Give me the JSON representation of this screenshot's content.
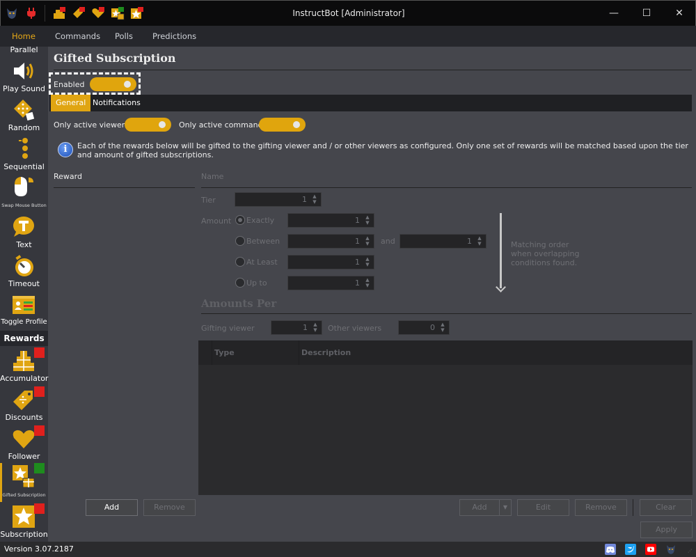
{
  "window": {
    "title": "InstructBot [Administrator]",
    "controls": {
      "minimize": "—",
      "maximize": "☐",
      "close": "✕"
    }
  },
  "toolbar_icons": [
    "bot-logo",
    "plug",
    "accumulator",
    "discounts",
    "follower",
    "gifted-subscription",
    "subscription"
  ],
  "menu": {
    "items": [
      {
        "label": "Home",
        "active": true
      },
      {
        "label": "Commands",
        "active": false
      },
      {
        "label": "Polls",
        "active": false
      },
      {
        "label": "Predictions",
        "active": false
      }
    ]
  },
  "sidebar": {
    "top_partial_label": "Parallel",
    "items": [
      {
        "label": "Play Sound",
        "icon": "speaker"
      },
      {
        "label": "Random",
        "icon": "dice"
      },
      {
        "label": "Sequential",
        "icon": "sequence"
      },
      {
        "label": "Swap Mouse Button",
        "icon": "mouse"
      },
      {
        "label": "Text",
        "icon": "text-bubble"
      },
      {
        "label": "Timeout",
        "icon": "stopwatch"
      },
      {
        "label": "Toggle Profile",
        "icon": "profile-toggle"
      }
    ],
    "rewards_header": "Rewards",
    "rewards": [
      {
        "label": "Accumulator",
        "icon": "gifts",
        "status": "red"
      },
      {
        "label": "Discounts",
        "icon": "tag",
        "status": "red"
      },
      {
        "label": "Follower",
        "icon": "heart",
        "status": "red"
      },
      {
        "label": "Gifted Subscription",
        "icon": "star-gift",
        "status": "green",
        "active": true
      },
      {
        "label": "Subscription",
        "icon": "star",
        "status": "red"
      }
    ]
  },
  "colors": {
    "accent": "#e0a512",
    "status_red": "#e0201d",
    "status_green": "#1e8c1e"
  },
  "main": {
    "title": "Gifted Subscription",
    "enabled_label": "Enabled",
    "enabled": true,
    "tabs": [
      {
        "label": "General",
        "active": true
      },
      {
        "label": "Notifications",
        "active": false
      }
    ],
    "only_active_viewers_label": "Only active viewers",
    "only_active_viewers": true,
    "only_active_commands_label": "Only active commands",
    "only_active_commands": true,
    "info_text": "Each of the rewards below will be gifted to the gifting viewer and / or other viewers as configured. Only one set of rewards will be matched based upon the tier and amount of gifted subscriptions.",
    "reward_list_header": "Reward",
    "form": {
      "name_label": "Name",
      "tier_label": "Tier",
      "tier_value": "1",
      "amount_label": "Amount",
      "amount_options": [
        {
          "label": "Exactly",
          "checked": true,
          "value": "1"
        },
        {
          "label": "Between",
          "checked": false,
          "value": "1",
          "and_label": "and",
          "value2": "1"
        },
        {
          "label": "At Least",
          "checked": false,
          "value": "1"
        },
        {
          "label": "Up to",
          "checked": false,
          "value": "1"
        }
      ],
      "matching_note": "Matching order when overlapping conditions found."
    },
    "amounts_per": {
      "title": "Amounts Per",
      "gifting_viewer_label": "Gifting viewer",
      "gifting_viewer_value": "1",
      "other_viewers_label": "Other viewers",
      "other_viewers_value": "0"
    },
    "grid": {
      "columns": [
        "Type",
        "Description"
      ],
      "rows": []
    },
    "buttons": {
      "reward_add": "Add",
      "reward_remove": "Remove",
      "item_add": "Add",
      "item_edit": "Edit",
      "item_remove": "Remove",
      "clear": "Clear",
      "apply": "Apply"
    }
  },
  "status": {
    "version": "Version 3.07.2187",
    "social": [
      "discord",
      "twitter",
      "youtube",
      "bot-logo"
    ]
  }
}
